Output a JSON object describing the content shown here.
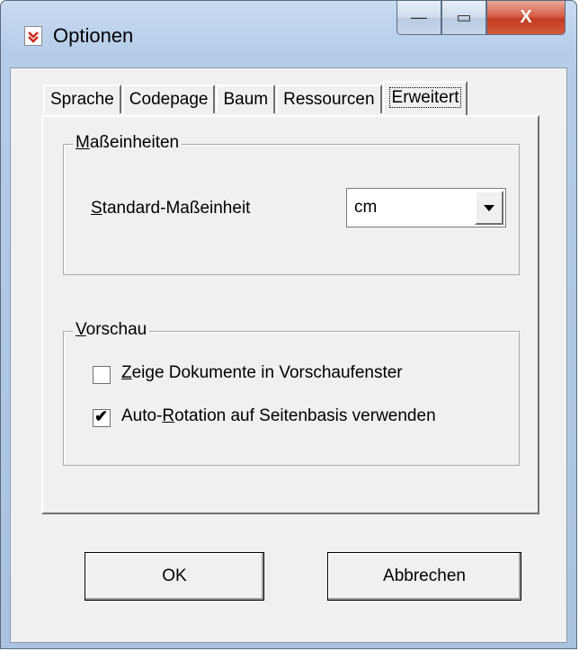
{
  "window": {
    "title": "Optionen",
    "close_glyph": "X",
    "min_glyph": "—",
    "max_glyph": "▭"
  },
  "tabs": [
    {
      "label": "Sprache"
    },
    {
      "label": "Codepage"
    },
    {
      "label": "Baum"
    },
    {
      "label": "Ressourcen"
    },
    {
      "label": "Erweitert",
      "active": true
    }
  ],
  "units_group": {
    "legend_accel": "M",
    "legend_rest": "aßeinheiten",
    "std_label_accel": "S",
    "std_label_rest": "tandard-Maßeinheit",
    "selected_unit": "cm"
  },
  "preview_group": {
    "legend_accel": "V",
    "legend_rest": "orschau",
    "show_docs": {
      "accel": "Z",
      "rest": "eige Dokumente in Vorschaufenster",
      "checked": false
    },
    "auto_rotation": {
      "prefix": "Auto-",
      "accel": "R",
      "rest": "otation auf Seitenbasis verwenden",
      "checked": true,
      "check_glyph": "✔"
    }
  },
  "buttons": {
    "ok": "OK",
    "cancel": "Abbrechen"
  }
}
